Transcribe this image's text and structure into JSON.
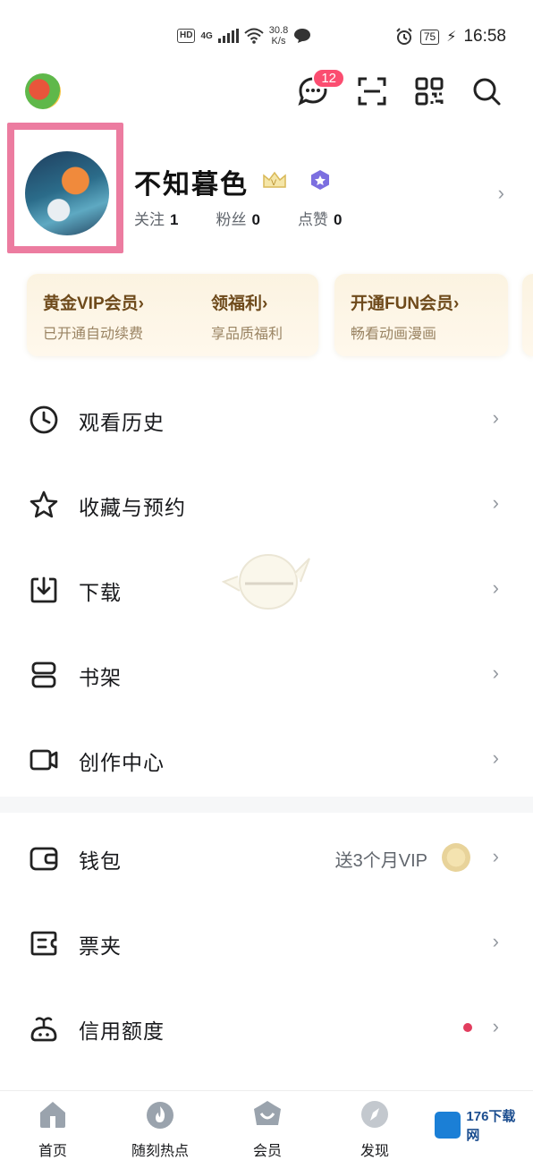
{
  "status_bar": {
    "hd": "HD",
    "network": "4G",
    "speed_value": "30.8",
    "speed_unit": "K/s",
    "battery": "75",
    "time": "16:58"
  },
  "top_bar": {
    "message_count": "12",
    "icons": [
      "message-icon",
      "scan-icon",
      "qr-code-icon",
      "search-icon"
    ]
  },
  "profile": {
    "username": "不知暮色",
    "stats": [
      {
        "label": "关注",
        "value": "1"
      },
      {
        "label": "粉丝",
        "value": "0"
      },
      {
        "label": "点赞",
        "value": "0"
      }
    ]
  },
  "vip_cards": [
    {
      "title": "黄金VIP会员›",
      "subtitle": "已开通自动续费"
    },
    {
      "title": "领福利›",
      "subtitle": "享品质福利"
    },
    {
      "title": "开通FUN会员›",
      "subtitle": "畅看动画漫画"
    }
  ],
  "menu_group_1": [
    {
      "label": "观看历史",
      "icon": "clock-icon"
    },
    {
      "label": "收藏与预约",
      "icon": "star-icon"
    },
    {
      "label": "下载",
      "icon": "download-icon"
    },
    {
      "label": "书架",
      "icon": "bookshelf-icon"
    },
    {
      "label": "创作中心",
      "icon": "camera-icon"
    }
  ],
  "menu_group_2": [
    {
      "label": "钱包",
      "icon": "wallet-icon",
      "extra": "送3个月VIP"
    },
    {
      "label": "票夹",
      "icon": "ticket-icon"
    },
    {
      "label": "信用额度",
      "icon": "credit-icon"
    }
  ],
  "tab_bar": [
    {
      "label": "首页",
      "icon": "home-icon"
    },
    {
      "label": "随刻热点",
      "icon": "flame-icon"
    },
    {
      "label": "会员",
      "icon": "crown-icon"
    },
    {
      "label": "发现",
      "icon": "compass-icon"
    }
  ],
  "watermark": "176下载网",
  "colors": {
    "accent_pink": "#fb4d70",
    "vip_gold": "#6e4a1b",
    "frame": "#ec7ca0"
  }
}
